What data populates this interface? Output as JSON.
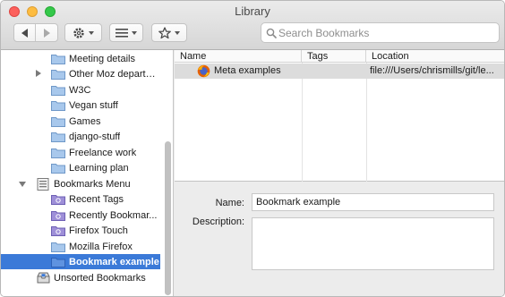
{
  "window": {
    "title": "Library"
  },
  "toolbar": {
    "back_icon": "back-arrow-icon",
    "forward_icon": "forward-arrow-icon",
    "organize_icon": "gear-icon",
    "views_icon": "list-icon",
    "import_icon": "star-icon"
  },
  "search": {
    "placeholder": "Search Bookmarks",
    "value": ""
  },
  "sidebar": {
    "items": [
      {
        "label": "Meeting details",
        "icon": "folder-icon"
      },
      {
        "label": "Other Moz department...",
        "icon": "folder-icon",
        "expandable": true
      },
      {
        "label": "W3C",
        "icon": "folder-icon"
      },
      {
        "label": "Vegan stuff",
        "icon": "folder-icon"
      },
      {
        "label": "Games",
        "icon": "folder-icon"
      },
      {
        "label": "django-stuff",
        "icon": "folder-icon"
      },
      {
        "label": "Freelance work",
        "icon": "folder-icon"
      },
      {
        "label": "Learning plan",
        "icon": "folder-icon"
      },
      {
        "label": "Bookmarks Menu",
        "icon": "bookmarks-menu-icon",
        "expanded": true
      },
      {
        "label": "Recent Tags",
        "icon": "smart-folder-icon"
      },
      {
        "label": "Recently Bookmar...",
        "icon": "smart-folder-icon"
      },
      {
        "label": "Firefox Touch",
        "icon": "smart-folder-icon"
      },
      {
        "label": "Mozilla Firefox",
        "icon": "folder-icon"
      },
      {
        "label": "Bookmark example",
        "icon": "folder-icon",
        "selected": true
      },
      {
        "label": "Unsorted Bookmarks",
        "icon": "unsorted-bookmarks-icon"
      }
    ]
  },
  "table": {
    "columns": [
      "Name",
      "Tags",
      "Location"
    ],
    "rows": [
      {
        "name": "Meta examples",
        "tags": "",
        "location": "file:///Users/chrismills/git/le..."
      }
    ]
  },
  "details": {
    "name_label": "Name:",
    "name_value": "Bookmark example",
    "description_label": "Description:",
    "description_value": ""
  },
  "colors": {
    "selection": "#3b7ad8",
    "folder": "#a8c8ec",
    "smart_folder": "#9e8fd8"
  }
}
